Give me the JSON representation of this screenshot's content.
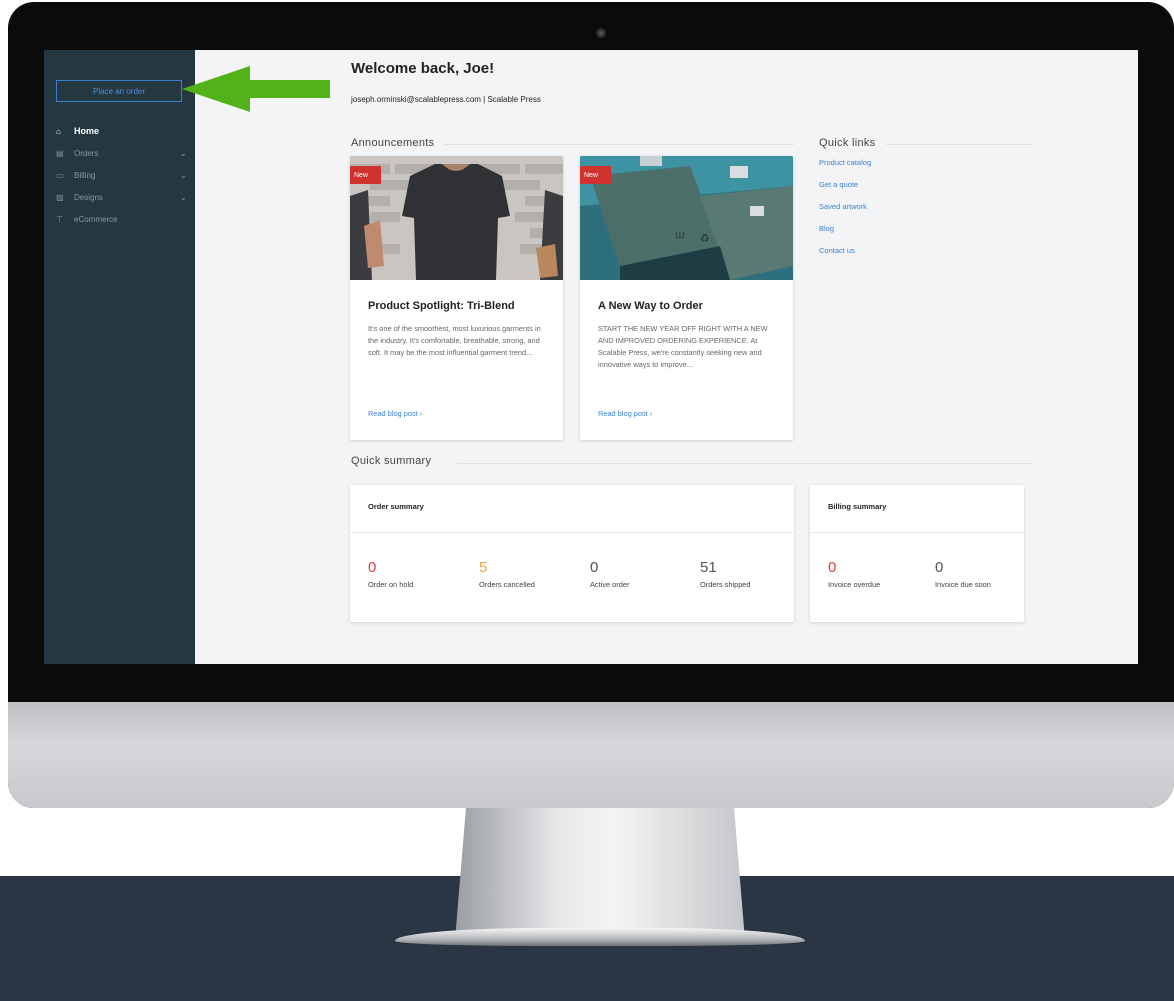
{
  "sidebar": {
    "place_order_label": "Place an order",
    "items": [
      {
        "icon": "home-icon",
        "glyph": "⌂",
        "label": "Home",
        "active": true,
        "expandable": false
      },
      {
        "icon": "orders-icon",
        "glyph": "▤",
        "label": "Orders",
        "active": false,
        "expandable": true
      },
      {
        "icon": "billing-icon",
        "glyph": "▭",
        "label": "Billing",
        "active": false,
        "expandable": true
      },
      {
        "icon": "designs-icon",
        "glyph": "▨",
        "label": "Designs",
        "active": false,
        "expandable": true
      },
      {
        "icon": "cart-icon",
        "glyph": "⊤",
        "label": "eCommerce",
        "active": false,
        "expandable": false
      }
    ]
  },
  "header": {
    "welcome": "Welcome back, Joe!",
    "account_line": "joseph.orminski@scalablepress.com | Scalable Press"
  },
  "announcements": {
    "title": "Announcements",
    "cards": [
      {
        "badge": "New",
        "title": "Product Spotlight: Tri-Blend",
        "body": "It's one of the smoothest, most luxurious garments in the industry. It's comfortable, breathable, strong, and soft. It may be the most influential garment trend...",
        "link": "Read blog post ›"
      },
      {
        "badge": "New",
        "title": "A New Way to Order",
        "body": "START THE NEW YEAR OFF RIGHT WITH A NEW AND IMPROVED ORDERING EXPERIENCE. At Scalable Press, we're constantly seeking new and innovative ways to improve...",
        "link": "Read blog post ›"
      }
    ]
  },
  "quick_links": {
    "title": "Quick links",
    "items": [
      "Product catalog",
      "Get a quote",
      "Saved artwork",
      "Blog",
      "Contact us"
    ]
  },
  "quick_summary": {
    "title": "Quick summary",
    "order_summary": {
      "heading": "Order summary",
      "stats": [
        {
          "value": "0",
          "label": "Order on hold",
          "color": "#d9413a"
        },
        {
          "value": "5",
          "label": "Orders cancelled",
          "color": "#f0a640"
        },
        {
          "value": "0",
          "label": "Active order",
          "color": "#555555"
        },
        {
          "value": "51",
          "label": "Orders shipped",
          "color": "#555555"
        }
      ]
    },
    "billing_summary": {
      "heading": "Billing summary",
      "stats": [
        {
          "value": "0",
          "label": "Invoice overdue",
          "color": "#d9413a"
        },
        {
          "value": "0",
          "label": "Invoice due soon",
          "color": "#555555"
        }
      ]
    }
  },
  "colors": {
    "accent": "#3a7fd8",
    "sidebar": "#253842",
    "arrow": "#52b21a",
    "badge": "#d0322e"
  }
}
